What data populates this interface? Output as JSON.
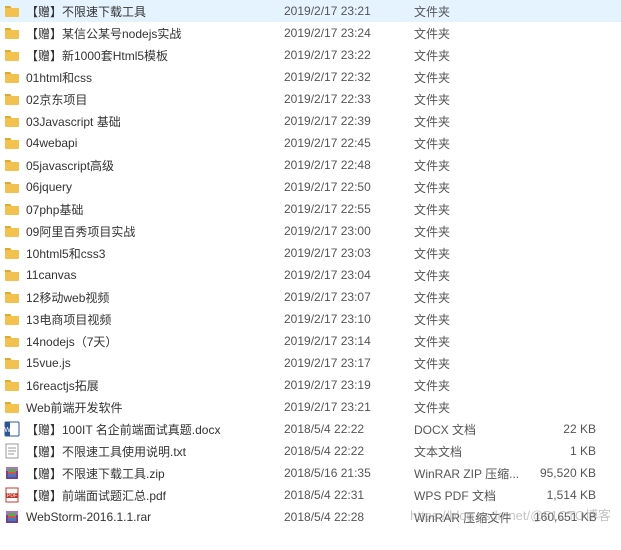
{
  "icons": {
    "folder": "folder-icon",
    "docx": "docx-icon",
    "txt": "txt-icon",
    "zip": "rar-icon",
    "pdf": "pdf-icon",
    "rar": "rar-icon"
  },
  "files": [
    {
      "name": "【赠】不限速下载工具",
      "date": "2019/2/17 23:21",
      "type": "文件夹",
      "size": "",
      "icon": "folder"
    },
    {
      "name": "【赠】某信公某号nodejs实战",
      "date": "2019/2/17 23:24",
      "type": "文件夹",
      "size": "",
      "icon": "folder"
    },
    {
      "name": "【赠】新1000套Html5模板",
      "date": "2019/2/17 23:22",
      "type": "文件夹",
      "size": "",
      "icon": "folder"
    },
    {
      "name": "01html和css",
      "date": "2019/2/17 22:32",
      "type": "文件夹",
      "size": "",
      "icon": "folder"
    },
    {
      "name": "02京东项目",
      "date": "2019/2/17 22:33",
      "type": "文件夹",
      "size": "",
      "icon": "folder"
    },
    {
      "name": "03Javascript 基础",
      "date": "2019/2/17 22:39",
      "type": "文件夹",
      "size": "",
      "icon": "folder"
    },
    {
      "name": "04webapi",
      "date": "2019/2/17 22:45",
      "type": "文件夹",
      "size": "",
      "icon": "folder"
    },
    {
      "name": "05javascript高级",
      "date": "2019/2/17 22:48",
      "type": "文件夹",
      "size": "",
      "icon": "folder"
    },
    {
      "name": "06jquery",
      "date": "2019/2/17 22:50",
      "type": "文件夹",
      "size": "",
      "icon": "folder"
    },
    {
      "name": "07php基础",
      "date": "2019/2/17 22:55",
      "type": "文件夹",
      "size": "",
      "icon": "folder"
    },
    {
      "name": "09阿里百秀项目实战",
      "date": "2019/2/17 23:00",
      "type": "文件夹",
      "size": "",
      "icon": "folder"
    },
    {
      "name": "10html5和css3",
      "date": "2019/2/17 23:03",
      "type": "文件夹",
      "size": "",
      "icon": "folder"
    },
    {
      "name": "11canvas",
      "date": "2019/2/17 23:04",
      "type": "文件夹",
      "size": "",
      "icon": "folder"
    },
    {
      "name": "12移动web视频",
      "date": "2019/2/17 23:07",
      "type": "文件夹",
      "size": "",
      "icon": "folder"
    },
    {
      "name": "13电商项目视频",
      "date": "2019/2/17 23:10",
      "type": "文件夹",
      "size": "",
      "icon": "folder"
    },
    {
      "name": "14nodejs（7天）",
      "date": "2019/2/17 23:14",
      "type": "文件夹",
      "size": "",
      "icon": "folder"
    },
    {
      "name": "15vue.js",
      "date": "2019/2/17 23:17",
      "type": "文件夹",
      "size": "",
      "icon": "folder"
    },
    {
      "name": "16reactjs拓展",
      "date": "2019/2/17 23:19",
      "type": "文件夹",
      "size": "",
      "icon": "folder"
    },
    {
      "name": "Web前端开发软件",
      "date": "2019/2/17 23:21",
      "type": "文件夹",
      "size": "",
      "icon": "folder"
    },
    {
      "name": "【赠】100IT 名企前端面试真题.docx",
      "date": "2018/5/4 22:22",
      "type": "DOCX 文档",
      "size": "22 KB",
      "icon": "docx"
    },
    {
      "name": "【赠】不限速工具使用说明.txt",
      "date": "2018/5/4 22:22",
      "type": "文本文档",
      "size": "1 KB",
      "icon": "txt"
    },
    {
      "name": "【赠】不限速下载工具.zip",
      "date": "2018/5/16 21:35",
      "type": "WinRAR ZIP 压缩...",
      "size": "95,520 KB",
      "icon": "zip"
    },
    {
      "name": "【赠】前端面试题汇总.pdf",
      "date": "2018/5/4 22:31",
      "type": "WPS PDF 文档",
      "size": "1,514 KB",
      "icon": "pdf"
    },
    {
      "name": "WebStorm-2016.1.1.rar",
      "date": "2018/5/4 22:28",
      "type": "WinRAR 压缩文件",
      "size": "160,651 KB",
      "icon": "rar"
    }
  ],
  "watermark": "https://blog.csdn.net/@51CTO博客"
}
